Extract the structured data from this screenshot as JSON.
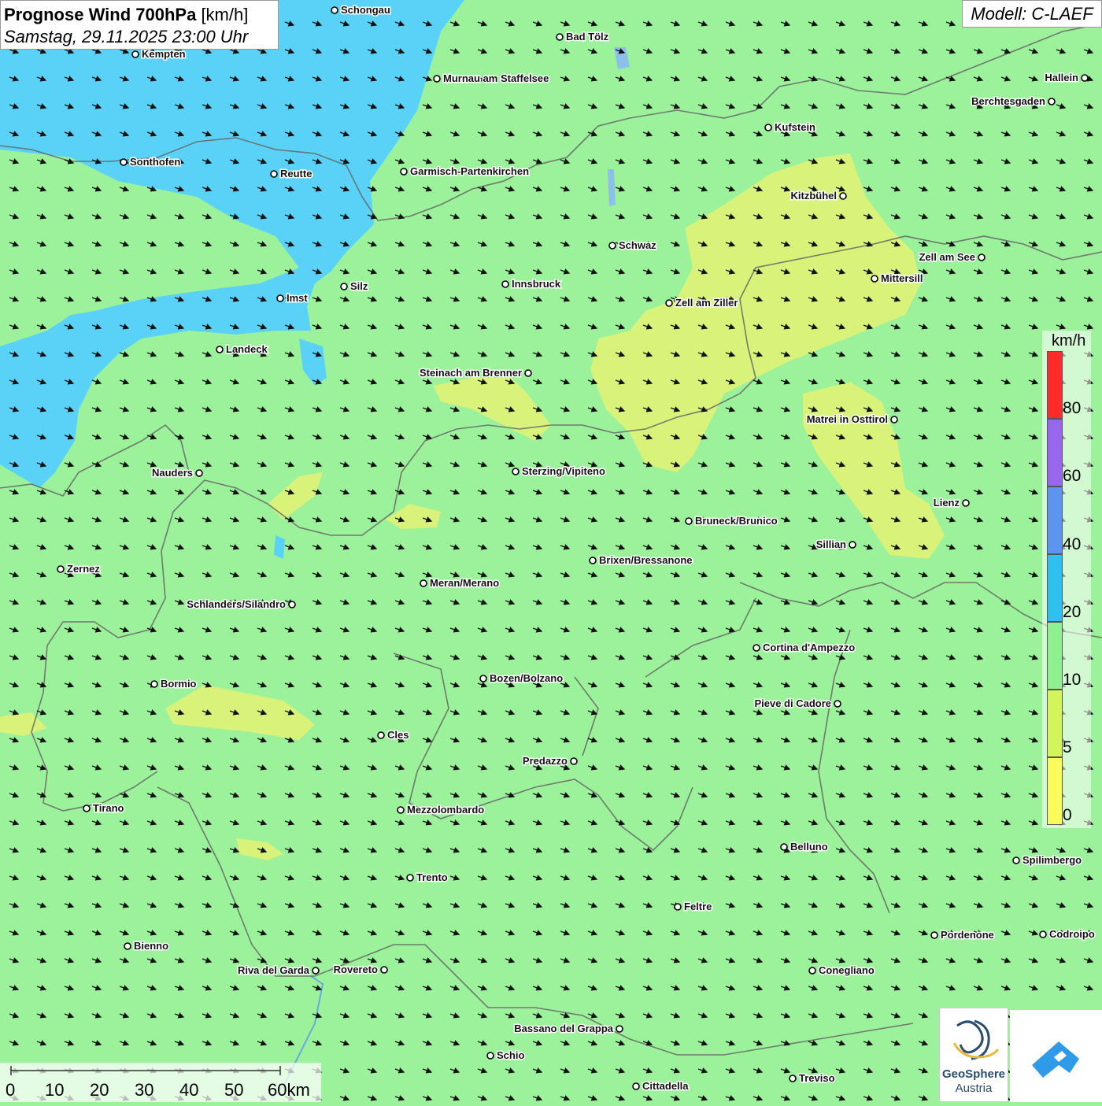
{
  "title": {
    "main_bold": "Prognose Wind 700hPa",
    "unit": "[km/h]",
    "datetime": "Samstag, 29.11.2025 23:00 Uhr"
  },
  "model_label": "Modell: C-LAEF",
  "legend": {
    "unit": "km/h",
    "ticks": [
      "80",
      "60",
      "40",
      "20",
      "10",
      "5",
      "0"
    ],
    "colors": [
      "#ff2a2a",
      "#9966ee",
      "#5b95ef",
      "#2ec0ef",
      "#8ef08e",
      "#d2f55a",
      "#fbfb5a"
    ]
  },
  "colors": {
    "calm_green": "#9bf29b",
    "light_blue": "#5ad2f8",
    "yellow_green": "#d8f27a",
    "arrow": "#111111",
    "border": "#666666",
    "lake": "#8cc0ea"
  },
  "scale_bar": {
    "labels": [
      "0",
      "10",
      "20",
      "30",
      "40",
      "50",
      "60km"
    ]
  },
  "cities": [
    {
      "name": "Schongau"
    },
    {
      "name": "Kempten"
    },
    {
      "name": "Bad Tölz"
    },
    {
      "name": "Murnau am Staffelsee"
    },
    {
      "name": "Hallein"
    },
    {
      "name": "Berchtesgaden"
    },
    {
      "name": "Kufstein"
    },
    {
      "name": "Sonthofen"
    },
    {
      "name": "Reutte"
    },
    {
      "name": "Garmisch-Partenkirchen"
    },
    {
      "name": "Kitzbühel"
    },
    {
      "name": "Schwaz"
    },
    {
      "name": "Zell am See"
    },
    {
      "name": "Silz"
    },
    {
      "name": "Innsbruck"
    },
    {
      "name": "Mittersill"
    },
    {
      "name": "Imst"
    },
    {
      "name": "Zell am Ziller"
    },
    {
      "name": "Landeck"
    },
    {
      "name": "Steinach am Brenner"
    },
    {
      "name": "Matrei in Osttirol"
    },
    {
      "name": "Nauders"
    },
    {
      "name": "Sterzing/Vipiteno"
    },
    {
      "name": "Lienz"
    },
    {
      "name": "Bruneck/Brunico"
    },
    {
      "name": "Sillian"
    },
    {
      "name": "Brixen/Bressanone"
    },
    {
      "name": "Zernez"
    },
    {
      "name": "Meran/Merano"
    },
    {
      "name": "Schlanders/Silandro"
    },
    {
      "name": "Cortina d'Ampezzo"
    },
    {
      "name": "Bozen/Bolzano"
    },
    {
      "name": "Bormio"
    },
    {
      "name": "Pieve di Cadore"
    },
    {
      "name": "Cles"
    },
    {
      "name": "Predazzo"
    },
    {
      "name": "Tirano"
    },
    {
      "name": "Mezzolombardo"
    },
    {
      "name": "Belluno"
    },
    {
      "name": "Spilimbergo"
    },
    {
      "name": "Trento"
    },
    {
      "name": "Feltre"
    },
    {
      "name": "Pordenone"
    },
    {
      "name": "Codroipo"
    },
    {
      "name": "Bienno"
    },
    {
      "name": "Riva del Garda"
    },
    {
      "name": "Rovereto"
    },
    {
      "name": "Conegliano"
    },
    {
      "name": "Bassano del Grappa"
    },
    {
      "name": "Schio"
    },
    {
      "name": "Treviso"
    },
    {
      "name": "Cittadella"
    }
  ],
  "logos": {
    "geosphere_line1": "GeoSphere",
    "geosphere_line2": "Austria"
  }
}
